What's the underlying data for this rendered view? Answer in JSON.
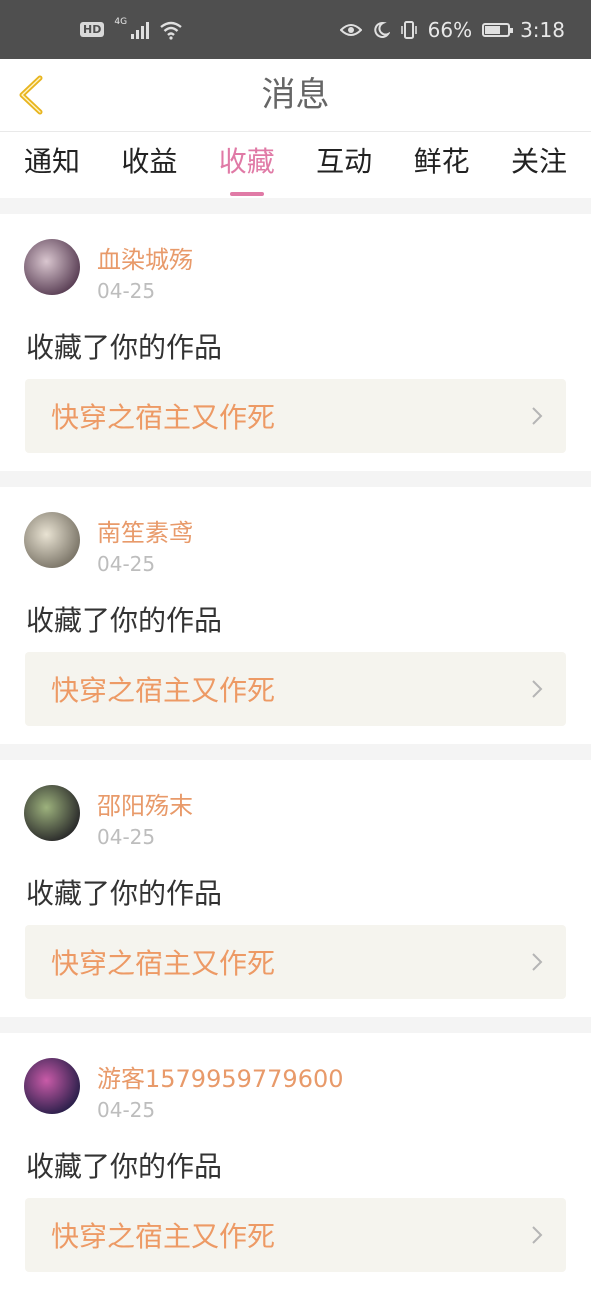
{
  "status_bar": {
    "hd": "HD",
    "network": "4G",
    "battery": "66%",
    "battery_level": 0.66,
    "time": "3:18"
  },
  "header": {
    "title": "消息"
  },
  "tabs": [
    {
      "label": "通知",
      "active": false
    },
    {
      "label": "收益",
      "active": false
    },
    {
      "label": "收藏",
      "active": true
    },
    {
      "label": "互动",
      "active": false
    },
    {
      "label": "鲜花",
      "active": false
    },
    {
      "label": "关注",
      "active": false
    }
  ],
  "messages": [
    {
      "user": "血染城殇",
      "date": "04-25",
      "action": "收藏了你的作品",
      "work": "快穿之宿主又作死",
      "avatar_colors": [
        "#5a3f55",
        "#d9c6cf"
      ]
    },
    {
      "user": "南笙素鸢",
      "date": "04-25",
      "action": "收藏了你的作品",
      "work": "快穿之宿主又作死",
      "avatar_colors": [
        "#7b7568",
        "#e9e3d3"
      ]
    },
    {
      "user": "邵阳殇末",
      "date": "04-25",
      "action": "收藏了你的作品",
      "work": "快穿之宿主又作死",
      "avatar_colors": [
        "#2a2a2a",
        "#9db27d"
      ]
    },
    {
      "user": "游客1579959779600",
      "date": "04-25",
      "action": "收藏了你的作品",
      "work": "快穿之宿主又作死",
      "avatar_colors": [
        "#2a1f4a",
        "#c95ba8"
      ]
    }
  ],
  "colors": {
    "accent": "#e07aa6",
    "username": "#e89a6a",
    "work_title": "#ed9a65",
    "back_arrow": "#e8b51f"
  }
}
